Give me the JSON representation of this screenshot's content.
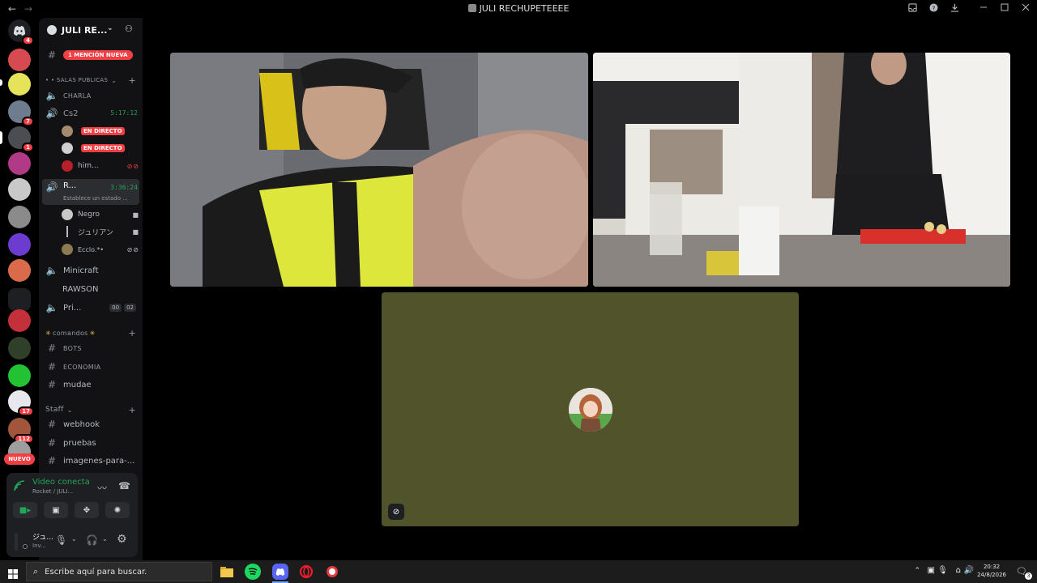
{
  "window": {
    "back_icon": "←",
    "forward_icon": "→",
    "title": "JULI RECHUPETEEEE"
  },
  "rail": {
    "dm_badge": "4",
    "servers": [
      {
        "color": "#d84a52",
        "badge": ""
      },
      {
        "color": "#e6e35b",
        "badge": ""
      },
      {
        "color": "#6f7c8d",
        "badge": "7"
      },
      {
        "color": "#4b4d52",
        "badge": "1"
      },
      {
        "color": "#b03a86",
        "badge": ""
      },
      {
        "color": "#c9c9c9",
        "badge": ""
      },
      {
        "color": "#8b8b8b",
        "badge": ""
      },
      {
        "color": "#6c3cd0",
        "badge": ""
      },
      {
        "color": "#d96b4a",
        "badge": ""
      },
      {
        "color": "#5865f2",
        "badge": ""
      },
      {
        "color": "#c4303a",
        "badge": ""
      },
      {
        "color": "#2f3f2a",
        "badge": ""
      },
      {
        "color": "#22c232",
        "badge": ""
      },
      {
        "color": "#e7e7ee",
        "badge": "17"
      },
      {
        "color": "#a1553a",
        "badge": "112"
      },
      {
        "color": "#9e9e9e",
        "badge": ""
      }
    ],
    "new_label": "NUEVO"
  },
  "sidebar": {
    "guild_name": "JULI RE...",
    "mention_banner": "1 MENCIÓN NUEVA",
    "cat_public": "• • SALAS PUBLICAS",
    "ch_charla": "CHARLA",
    "ch_cs2": "Cs2",
    "cs2_timer": "5:17:12",
    "live_label": "EN DIRECTO",
    "user_him": "him...",
    "ch_current": "R...",
    "current_timer": "3:36:24",
    "current_status": "Establece un estado ...",
    "user_negro": "Negro",
    "user_juri": "ジュリアン",
    "user_ecclo": "Ecclo.*•",
    "ch_minicraft": "Minicraft",
    "ch_rawson": "RAWSON",
    "ch_private": "Pri...",
    "private_count_a": "00",
    "private_count_b": "02",
    "cat_comandos": "comandos",
    "ch_bots": "BOTS",
    "ch_economia": "ECONOMIA",
    "ch_mudae": "mudae",
    "cat_staff": "Staff",
    "ch_webhook": "webhook",
    "ch_pruebas": "pruebas",
    "ch_imagenes": "imagenes-para-..."
  },
  "voice_panel": {
    "status": "Video conectado",
    "sub": "Rocket / JULI...",
    "user_name": "ジュ...",
    "user_sub": "Inv..."
  },
  "taskbar": {
    "search_placeholder": "Escribe aquí para buscar.",
    "time": "20:32",
    "date": "24/8/2026",
    "notif_count": "3"
  }
}
